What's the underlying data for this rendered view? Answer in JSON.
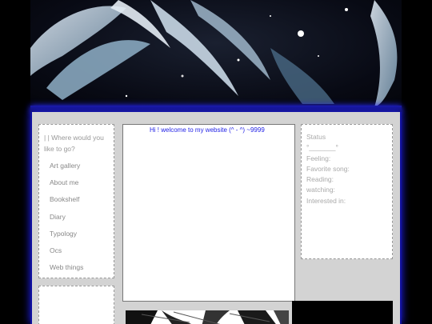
{
  "nav": {
    "title": "| | Where would you like to go?",
    "items": [
      "Art gallery",
      "About me",
      "Bookshelf",
      "Diary",
      "Typology",
      "Ocs",
      "Web things"
    ]
  },
  "main": {
    "welcome": "Hi ! welcome to my website (^ - ^) ~9999"
  },
  "status": {
    "title": "Status",
    "divider": "°_______°",
    "lines": [
      "Feeling:",
      "Favorite song:",
      "Reading:",
      "watching:",
      "Interested in:"
    ]
  },
  "colors": {
    "accent_blue": "#1e1ee6",
    "frame_glow": "#1f1fff",
    "panel_bg": "#d3d3d3"
  }
}
